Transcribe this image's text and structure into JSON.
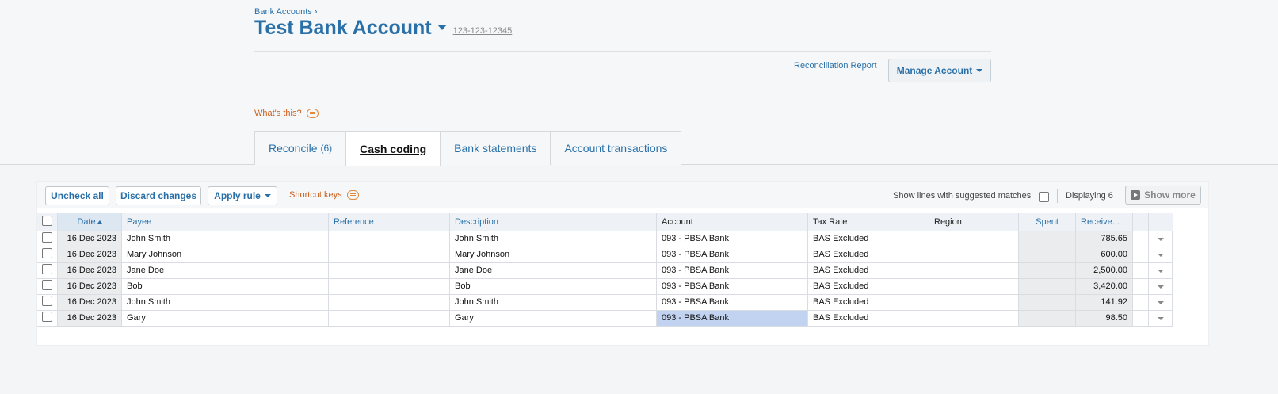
{
  "header": {
    "breadcrumb": "Bank Accounts ›",
    "title": "Test Bank Account",
    "account_number": "123-123-12345",
    "reconciliation_report": "Reconciliation Report",
    "manage_account": "Manage Account",
    "whats_this": "What's this?"
  },
  "tabs": [
    {
      "label": "Reconcile",
      "badge": "(6)"
    },
    {
      "label": "Cash coding"
    },
    {
      "label": "Bank statements"
    },
    {
      "label": "Account transactions"
    }
  ],
  "toolbar": {
    "uncheck_all": "Uncheck all",
    "discard_changes": "Discard changes",
    "apply_rule": "Apply rule",
    "shortcut_keys": "Shortcut keys",
    "show_lines": "Show lines with suggested matches",
    "displaying": "Displaying 6",
    "show_more": "Show more"
  },
  "columns": {
    "date": "Date",
    "payee": "Payee",
    "reference": "Reference",
    "description": "Description",
    "account": "Account",
    "tax_rate": "Tax Rate",
    "region": "Region",
    "spent": "Spent",
    "received": "Receive..."
  },
  "rows": [
    {
      "date": "16 Dec 2023",
      "payee": "John Smith",
      "reference": "",
      "description": "John Smith",
      "account": "093 - PBSA Bank",
      "tax_rate": "BAS Excluded",
      "region": "",
      "spent": "",
      "received": "785.65"
    },
    {
      "date": "16 Dec 2023",
      "payee": "Mary Johnson",
      "reference": "",
      "description": "Mary Johnson",
      "account": "093 - PBSA Bank",
      "tax_rate": "BAS Excluded",
      "region": "",
      "spent": "",
      "received": "600.00"
    },
    {
      "date": "16 Dec 2023",
      "payee": "Jane Doe",
      "reference": "",
      "description": "Jane Doe",
      "account": "093 - PBSA Bank",
      "tax_rate": "BAS Excluded",
      "region": "",
      "spent": "",
      "received": "2,500.00"
    },
    {
      "date": "16 Dec 2023",
      "payee": "Bob",
      "reference": "",
      "description": "Bob",
      "account": "093 - PBSA Bank",
      "tax_rate": "BAS Excluded",
      "region": "",
      "spent": "",
      "received": "3,420.00"
    },
    {
      "date": "16 Dec 2023",
      "payee": "John Smith",
      "reference": "",
      "description": "John Smith",
      "account": "093 - PBSA Bank",
      "tax_rate": "BAS Excluded",
      "region": "",
      "spent": "",
      "received": "141.92"
    },
    {
      "date": "16 Dec 2023",
      "payee": "Gary",
      "reference": "",
      "description": "Gary",
      "account": "093 - PBSA Bank",
      "tax_rate": "BAS Excluded",
      "region": "",
      "spent": "",
      "received": "98.50"
    }
  ],
  "colors": {
    "link": "#2a70a8",
    "accent_orange": "#cc5e1c",
    "selected_cell": "#c2d3f1"
  }
}
